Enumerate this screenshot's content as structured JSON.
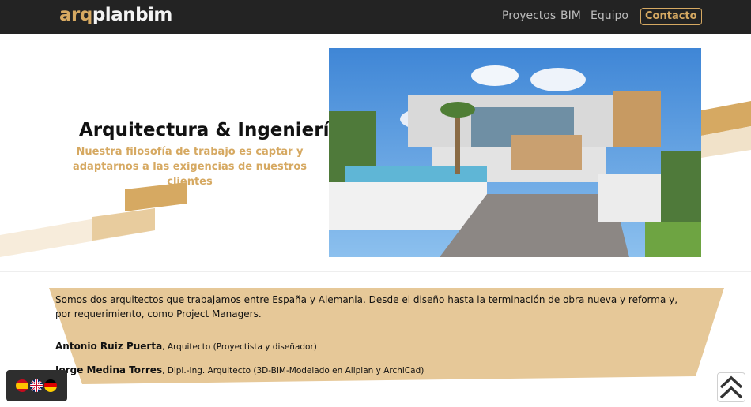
{
  "nav": {
    "logo_part1": "arq",
    "logo_part2": "planbim",
    "items": [
      {
        "label": "Proyectos"
      },
      {
        "label": "BIM"
      },
      {
        "label": "Equipo"
      }
    ],
    "contact_label": "Contacto"
  },
  "hero": {
    "title": "Arquitectura & Ingeniería",
    "subtitle": "Nuestra filosofía de trabajo es captar y adaptarnos a las exigencias de nuestros clientes"
  },
  "about": {
    "text": "Somos dos arquitectos que trabajamos entre España y Alemania. Desde el diseño hasta la terminación de obra nueva y reforma y, por requerimiento, como Project Managers.",
    "people": [
      {
        "name": "Antonio Ruiz Puerta",
        "role": ", Arquitecto (Proyectista y diseñador)"
      },
      {
        "name": "Jorge Medina Torres",
        "role": ", Dipl.-Ing. Arquitecto (3D-BIM-Modelado en Allplan y ArchiCad)"
      }
    ]
  },
  "languages": [
    {
      "icon": "spain-flag-icon"
    },
    {
      "icon": "uk-flag-icon"
    },
    {
      "icon": "germany-flag-icon"
    }
  ],
  "colors": {
    "accent": "#d6a962",
    "nav_bg": "#232323",
    "band": "#e6c898"
  }
}
